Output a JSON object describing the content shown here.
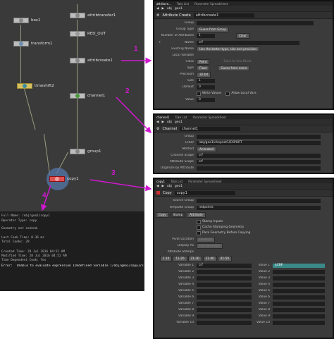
{
  "network": {
    "nodes": {
      "box1": "box1",
      "transform1": "transform1",
      "attribtransfer1": "attribtransfer1",
      "red_out": "RED_OUT",
      "attribcreate1": "attribcreate1",
      "timeshift2": "timeshift2",
      "channel1": "channel1",
      "group1": "group1",
      "copy1": "copy1"
    }
  },
  "callouts": {
    "one": "1",
    "two": "2",
    "three": "3",
    "four": "4"
  },
  "info": {
    "full_name": "Full Name:           /obj/geo1/copy1",
    "op_type": "Operator Type:   copy",
    "geo_state": "Geometry not cooked.",
    "last_cook": "Last Cook Time:   0.36 ms",
    "total_cooks": "Total Cooks:  29",
    "created": "Created Time:  28 Jul 2016 04:52 AM",
    "modified": "Modified Time:  28 Jul 2016 04:52 AM",
    "dependent": "Time Dependent Cook: Yes",
    "error_label": "Error:",
    "error_text": "Unable to evaluate expression (Undefined variable (/obj/geo1/copy1/stamp1))"
  },
  "panel1": {
    "tabs": [
      "attribcre...",
      "Take List",
      "Parameter Spreadsheet"
    ],
    "path": [
      "obj",
      "geo1"
    ],
    "op_type": "Attribute Create",
    "op_name": "attribcreate1",
    "rows": {
      "group": "Group",
      "group_type_label": "Group Type",
      "group_type": "Guess from Group",
      "num_label": "Number of Attributes",
      "num": "1",
      "clear": "Clear",
      "name_label": "Name",
      "name": "crf",
      "existing_label": "Existing Name",
      "existing": "Use the better type, size and precision",
      "local_var": "Local Variable",
      "class_label": "Class",
      "class_val": "Point",
      "save_info": "Save to Info Block",
      "type_label": "Type",
      "type_val": "Float",
      "guess_name": "Guess from name",
      "precision_label": "Precision",
      "precision": "32-bit",
      "size_label": "Size",
      "size": "1",
      "default_label": "Default",
      "default": "0",
      "write_values": "Write Values",
      "allow_local": "Allow Local Vars",
      "value_label": "Value",
      "value": "0"
    }
  },
  "panel2": {
    "tabs": [
      "channel1",
      "Take List",
      "Parameter Spreadsheet"
    ],
    "path": [
      "obj",
      "geo1"
    ],
    "op_type": "Channel",
    "op_name": "channel1",
    "rows": {
      "group": "Group",
      "chop_label": "CHOP",
      "chop": "/obj/geo1/chopnet1/EXPORT",
      "method_label": "Method",
      "method": "Animated",
      "channel_scope_label": "Channel Scope",
      "channel_scope": "crf",
      "attr_scope_label": "Attribute Scope",
      "attr_scope": "crf",
      "organize_label": "Organize by Attribute"
    }
  },
  "panel3": {
    "tabs": [
      "copy1",
      "Take List",
      "Parameter Spreadsheet"
    ],
    "path": [
      "obj",
      "geo1"
    ],
    "op_type": "Copy",
    "op_name": "copy1",
    "source_group": "Source Group",
    "template_group_label": "Template Group",
    "template_group": "redpoints",
    "subtabs": [
      "Copy",
      "Stamp",
      "Attribute"
    ],
    "stamp_inputs": "Stamp Inputs",
    "cache_stamping": "Cache Stamping Geometry",
    "pack_geo": "Pack Geometry Before Copying",
    "pivot_label": "Pivot Location",
    "pivot": "Centroid",
    "display_label": "Display As",
    "display": "Full Geometry",
    "attr_stamps": "Attribute Stamps",
    "stamp_counts": [
      "1.10",
      "11-20",
      "21-30",
      "31-40",
      "41-50"
    ],
    "var1_label": "Variable 1",
    "var1": "crf",
    "value1_label": "Value 1",
    "value1": "$CRF",
    "vars": [
      {
        "v": "Variable 2",
        "val": "Value 2"
      },
      {
        "v": "Variable 3",
        "val": "Value 3"
      },
      {
        "v": "Variable 4",
        "val": "Value 4"
      },
      {
        "v": "Variable 5",
        "val": "Value 5"
      },
      {
        "v": "Variable 6",
        "val": "Value 6"
      },
      {
        "v": "Variable 7",
        "val": "Value 7"
      },
      {
        "v": "Variable 8",
        "val": "Value 8"
      },
      {
        "v": "Variable 9",
        "val": "Value 9"
      },
      {
        "v": "Variable 10",
        "val": "Value 10"
      }
    ]
  },
  "colors": {
    "arrow": "#d018d0",
    "node_body": "#bdbdbd",
    "highlight": "#3b8a8a"
  }
}
